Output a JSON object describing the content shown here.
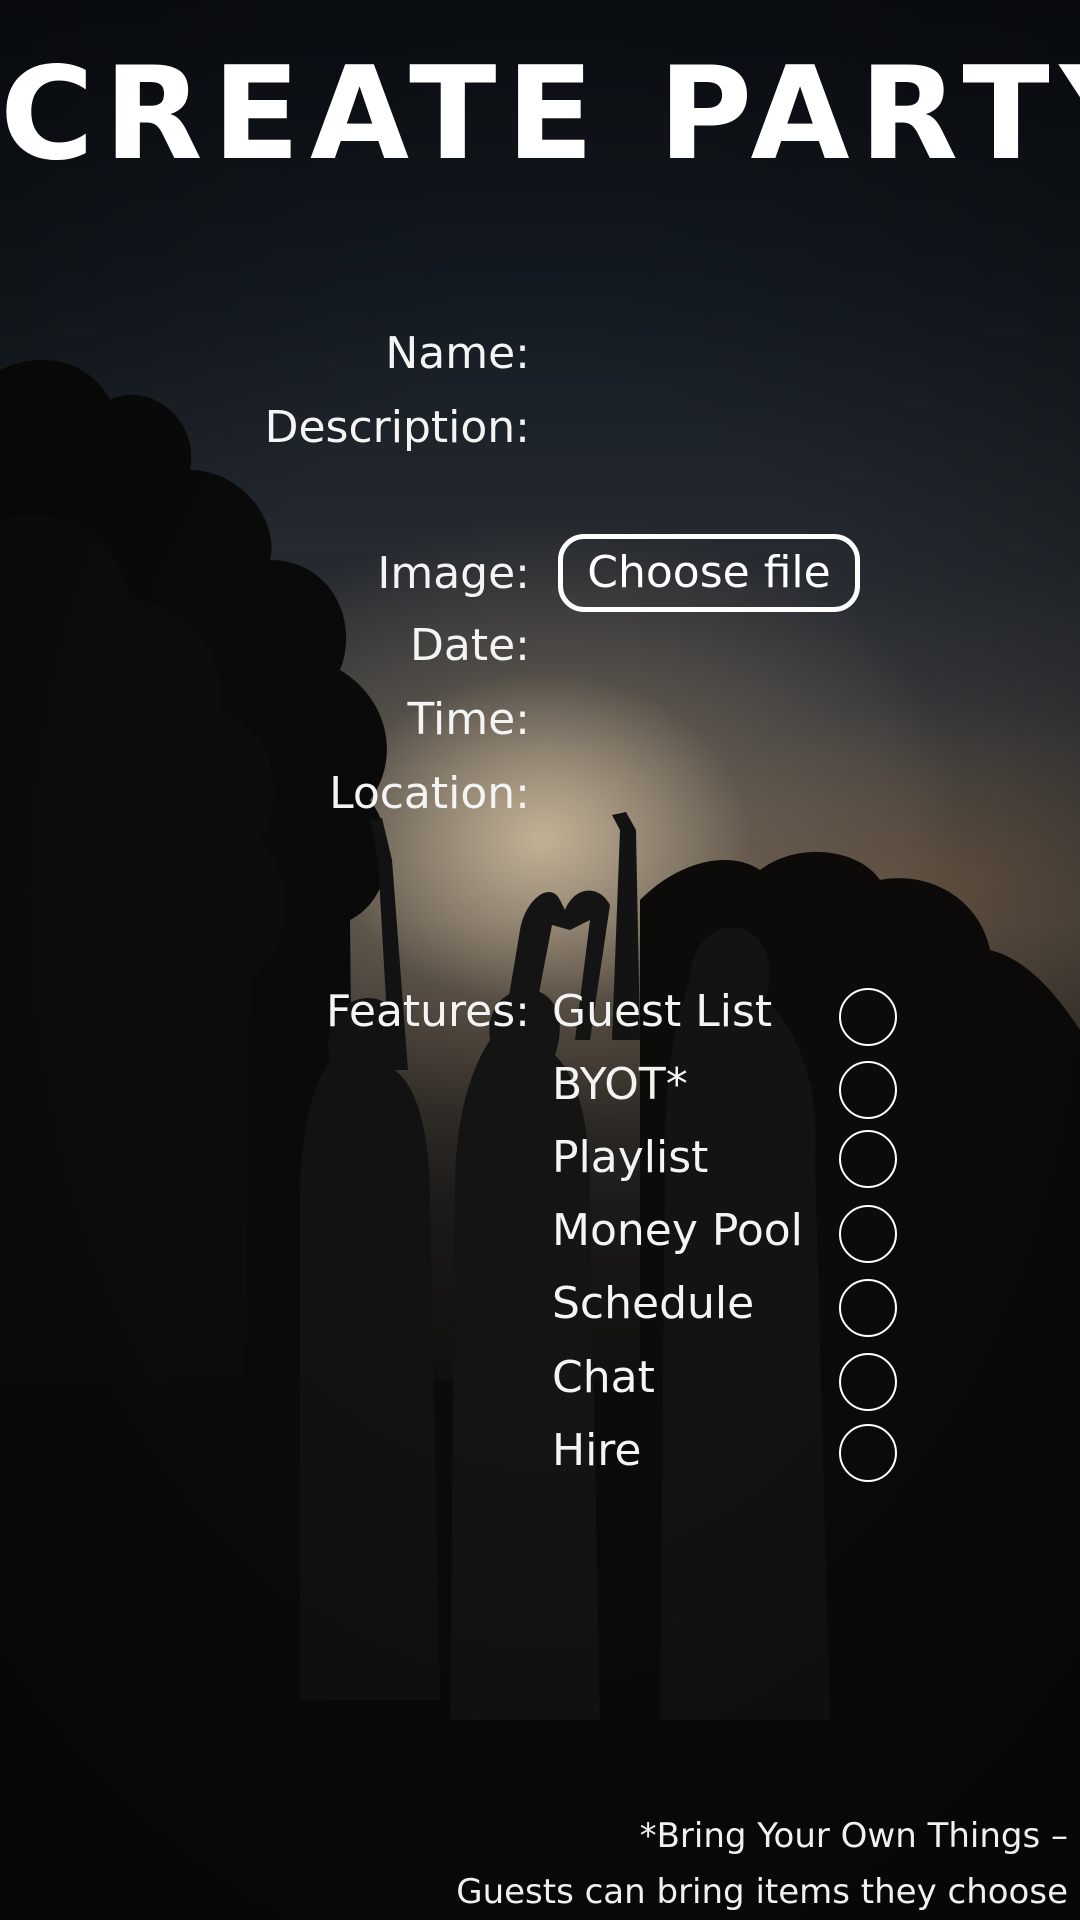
{
  "page": {
    "title": "CREATE PARTY"
  },
  "form": {
    "name_label": "Name:",
    "description_label": "Description:",
    "image_label": "Image:",
    "choose_file_label": "Choose file",
    "date_label": "Date:",
    "time_label": "Time:",
    "location_label": "Location:",
    "features_label": "Features:"
  },
  "features": [
    {
      "label": "Guest List",
      "selected": false
    },
    {
      "label": "BYOT*",
      "selected": false
    },
    {
      "label": "Playlist",
      "selected": false
    },
    {
      "label": "Money Pool",
      "selected": false
    },
    {
      "label": "Schedule",
      "selected": false
    },
    {
      "label": "Chat",
      "selected": false
    },
    {
      "label": "Hire",
      "selected": false
    }
  ],
  "footnote": {
    "line1": "*Bring Your Own Things –",
    "line2": "Guests can bring items they choose"
  },
  "colors": {
    "text": "#ffffff",
    "background": "#0b0d10"
  }
}
